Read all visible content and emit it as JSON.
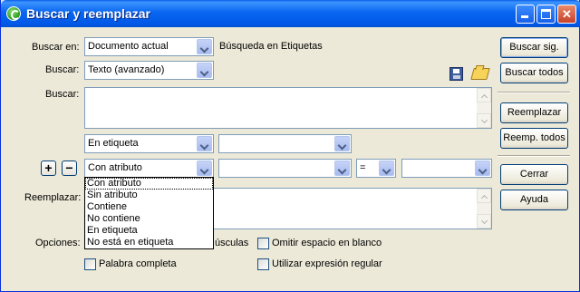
{
  "window": {
    "title": "Buscar y reemplazar"
  },
  "search_in": {
    "label": "Buscar en:",
    "value": "Documento actual",
    "description": "Búsqueda en Etiquetas"
  },
  "search_type": {
    "label": "Buscar:",
    "value": "Texto (avanzado)"
  },
  "search_text": {
    "label": "Buscar:",
    "value": ""
  },
  "tag_row": {
    "condition": "En etiqueta",
    "tag": ""
  },
  "attr_row": {
    "condition": "Con atributo",
    "attribute": "",
    "operator": "=",
    "value": "",
    "add_label": "+",
    "remove_label": "−",
    "options": [
      "Con atributo",
      "Sin atributo",
      "Contiene",
      "No contiene",
      "En etiqueta",
      "No está en etiqueta"
    ]
  },
  "replace": {
    "label": "Reemplazar:",
    "value": ""
  },
  "options": {
    "label": "Opciones:",
    "match_case_tail": "úsculas",
    "ignore_whitespace": "Omitir espacio en blanco",
    "whole_word": "Palabra completa",
    "regex": "Utilizar expresión regular"
  },
  "buttons": {
    "find_next": "Buscar sig.",
    "find_all": "Buscar todos",
    "replace": "Reemplazar",
    "replace_all": "Reemp. todos",
    "close": "Cerrar",
    "help": "Ayuda"
  },
  "icons": {
    "app": "dreamweaver-app-icon",
    "save": "save-query-icon",
    "open": "load-query-folder-icon"
  },
  "colors": {
    "titlebar": "#0058e6",
    "dialog_bg": "#ece9d8",
    "field_border": "#7f9db9"
  }
}
